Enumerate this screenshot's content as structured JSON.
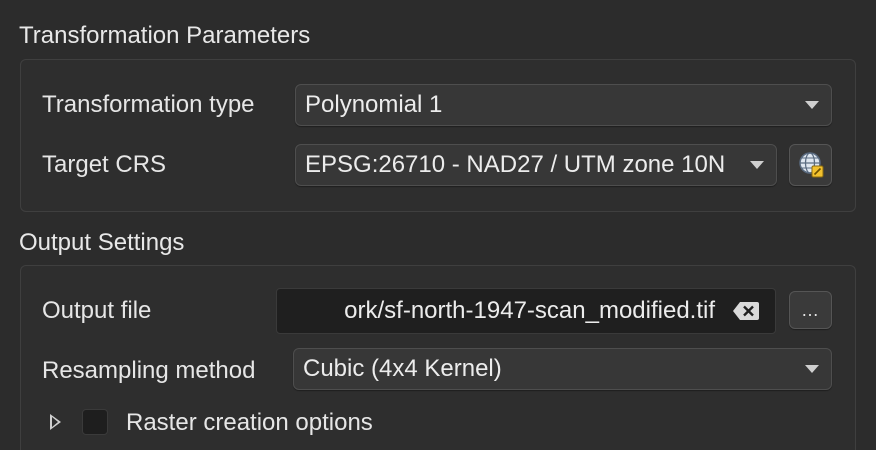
{
  "transformation_section": {
    "title": "Transformation Parameters",
    "transformation_type": {
      "label": "Transformation type",
      "selected": "Polynomial 1"
    },
    "target_crs": {
      "label": "Target CRS",
      "selected": "EPSG:26710 - NAD27 / UTM zone 10N",
      "select_crs_icon": "globe-crs-icon"
    }
  },
  "output_section": {
    "title": "Output Settings",
    "output_file": {
      "label": "Output file",
      "value": "ork/sf-north-1947-scan_modified.tif",
      "clear_icon": "clear-field-icon",
      "browse_label": "…"
    },
    "resampling": {
      "label": "Resampling method",
      "selected": "Cubic (4x4 Kernel)"
    },
    "raster_options": {
      "label": "Raster creation options",
      "checked": false
    }
  }
}
